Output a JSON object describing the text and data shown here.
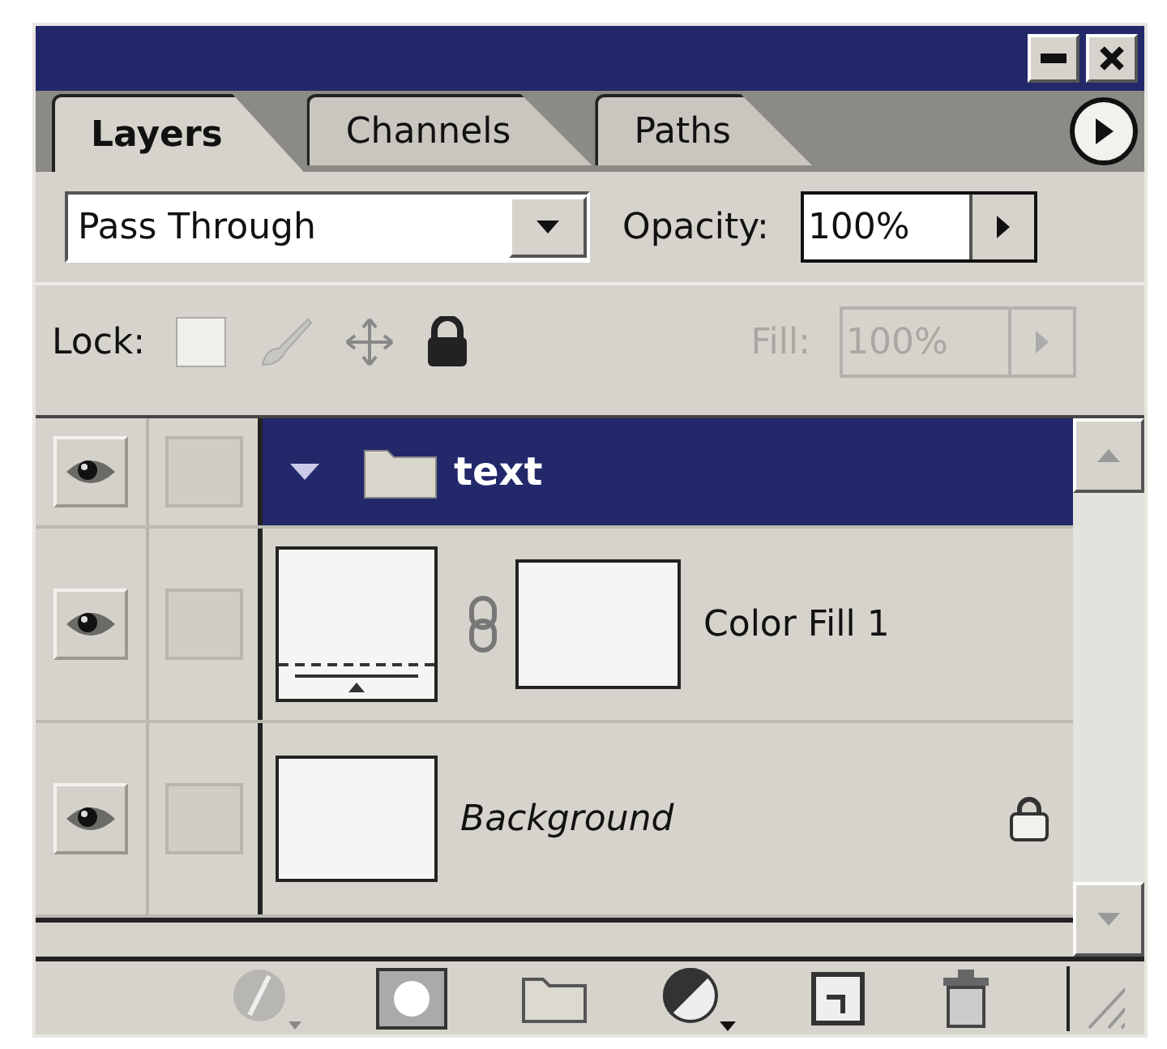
{
  "tabs": [
    {
      "label": "Layers",
      "selected": true
    },
    {
      "label": "Channels",
      "selected": false
    },
    {
      "label": "Paths",
      "selected": false
    }
  ],
  "blend_mode": {
    "value": "Pass Through"
  },
  "opacity": {
    "label": "Opacity:",
    "value": "100%"
  },
  "lock": {
    "label": "Lock:"
  },
  "fill": {
    "label": "Fill:",
    "value": "100%",
    "disabled": true
  },
  "layers": [
    {
      "kind": "group",
      "name": "text",
      "selected": true,
      "visible": true,
      "expanded": true,
      "locked": false
    },
    {
      "kind": "fill",
      "name": "Color Fill 1",
      "selected": false,
      "visible": true,
      "locked": false
    },
    {
      "kind": "background",
      "name": "Background",
      "selected": false,
      "visible": true,
      "locked": true
    }
  ]
}
